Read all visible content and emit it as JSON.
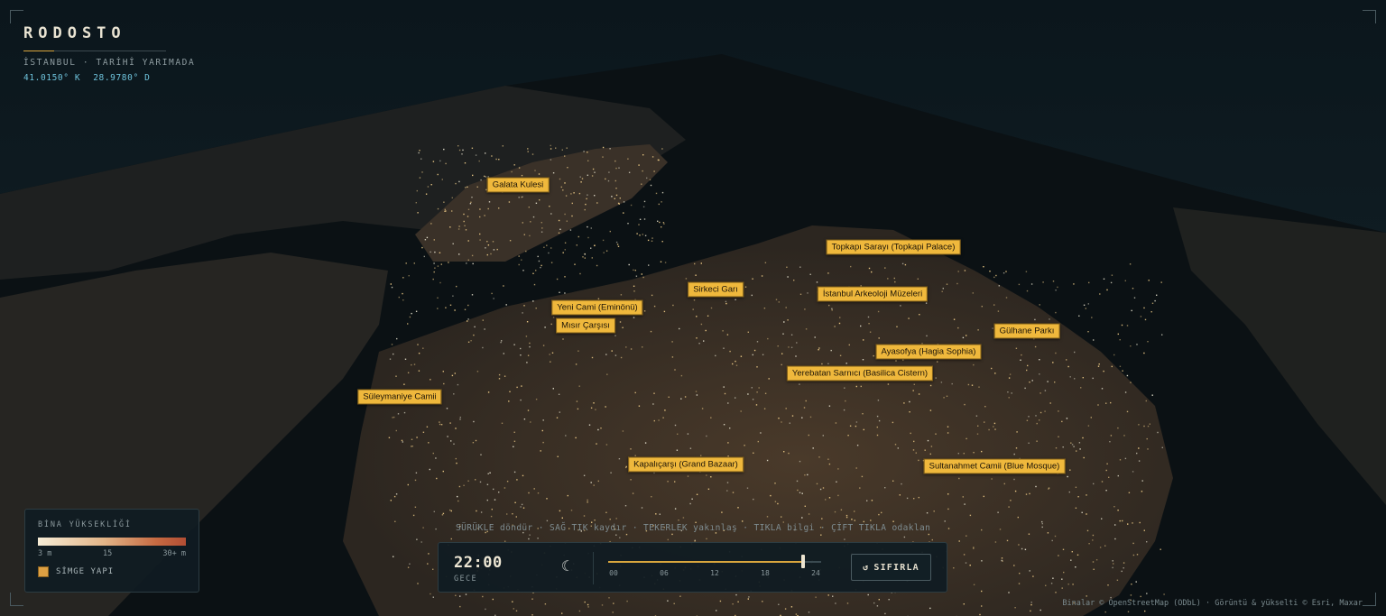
{
  "brand": {
    "title": "RODOSTO",
    "subtitle": "İSTANBUL · TARİHİ YARIMADA",
    "lat": "41.0150° K",
    "lon": "28.9780° D"
  },
  "landmarks": [
    {
      "label": "Galata Kulesi"
    },
    {
      "label": "Topkapı Sarayı (Topkapi Palace)"
    },
    {
      "label": "Sirkeci Garı"
    },
    {
      "label": "İstanbul Arkeoloji Müzeleri"
    },
    {
      "label": "Yeni Cami (Eminönü)"
    },
    {
      "label": "Mısır Çarşısı"
    },
    {
      "label": "Gülhane Parkı"
    },
    {
      "label": "Ayasofya (Hagia Sophia)"
    },
    {
      "label": "Yerebatan Sarnıcı (Basilica Cistern)"
    },
    {
      "label": "Süleymaniye Camii"
    },
    {
      "label": "Kapalıçarşı (Grand Bazaar)"
    },
    {
      "label": "Sultanahmet Camii (Blue Mosque)"
    }
  ],
  "legend": {
    "title": "BİNA YÜKSEKLİĞİ",
    "tick_min": "3 m",
    "tick_mid": "15",
    "tick_max": "30+ m",
    "landmark_key": "SİMGE YAPI"
  },
  "controls_hint": "SÜRÜKLE döndür · SAĞ TIK kaydır · TEKERLEK yakınlaş · TIKLA bilgi · ÇİFT TIKLA odaklan",
  "timebar": {
    "time": "22:00",
    "period": "GECE",
    "icon": "moon-icon",
    "hour": 22,
    "slider_min": 0,
    "slider_max": 24,
    "ticks": [
      "00",
      "06",
      "12",
      "18",
      "24"
    ],
    "reset_label": "SIFIRLA",
    "reset_icon": "↺"
  },
  "attribution": "Binalar © OpenStreetMap (ODbL) · Görüntü & yükselti © Esri, Maxar",
  "colors": {
    "accent": "#d9a63d",
    "landmark_fill": "#efb83c",
    "water": "#0b1114",
    "building_low": "#f6ecd6",
    "building_high": "#b24e34"
  }
}
